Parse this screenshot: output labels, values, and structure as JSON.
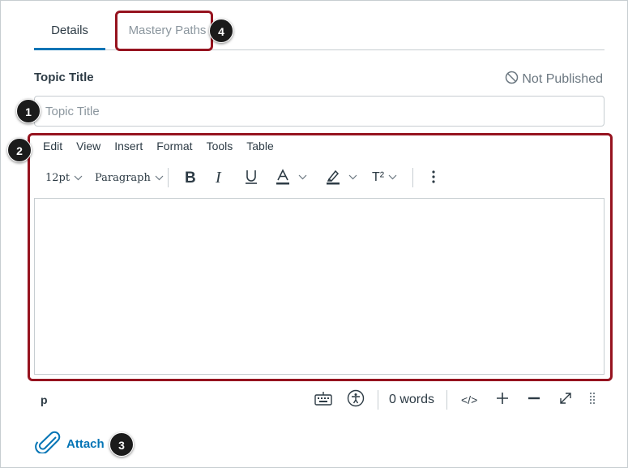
{
  "tabs": [
    {
      "label": "Details"
    },
    {
      "label": "Mastery Paths"
    }
  ],
  "topic": {
    "label": "Topic Title",
    "placeholder": "Topic Title",
    "value": ""
  },
  "publish_status": "Not Published",
  "editor": {
    "menu": [
      "Edit",
      "View",
      "Insert",
      "Format",
      "Tools",
      "Table"
    ],
    "font_size": "12pt",
    "block_format": "Paragraph",
    "superscript_label": "T²",
    "element_path": "p",
    "word_count": "0 words",
    "html_toggle": "</>"
  },
  "attach_label": "Attach",
  "badges": [
    "1",
    "2",
    "3",
    "4"
  ],
  "colors": {
    "accent": "#0374b5",
    "highlight": "#96131f",
    "text": "#2d3b45",
    "muted": "#8b969e"
  }
}
